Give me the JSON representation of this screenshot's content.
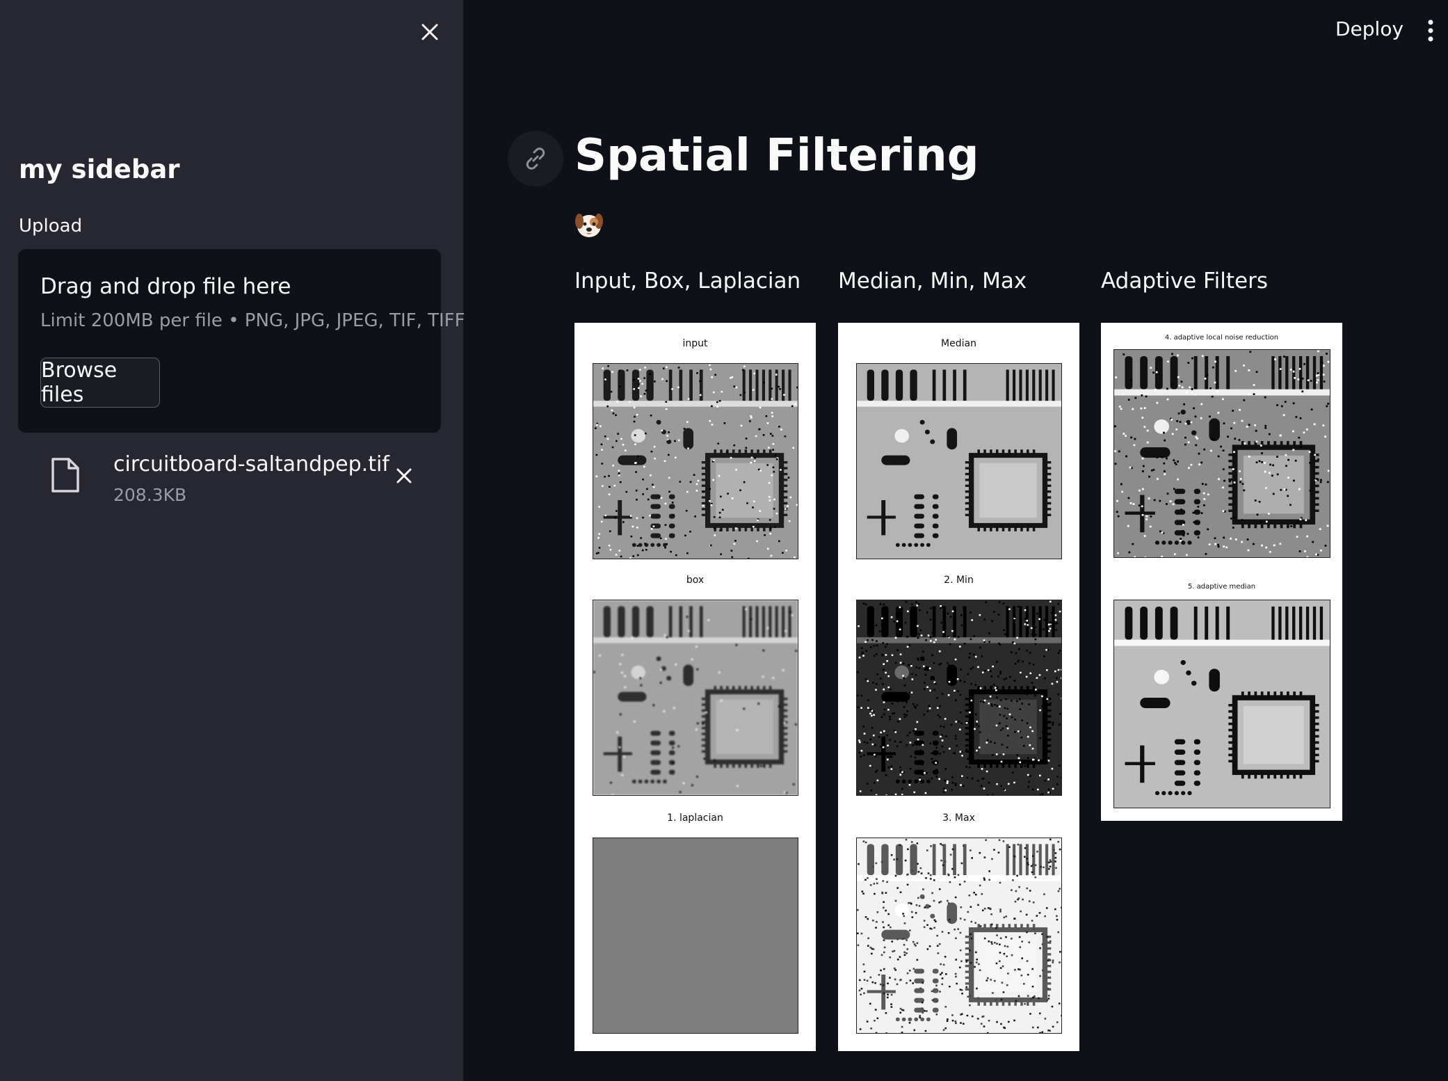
{
  "sidebar": {
    "title": "my sidebar",
    "upload_label": "Upload",
    "dropzone": {
      "title": "Drag and drop file here",
      "limit": "Limit 200MB per file • PNG, JPG, JPEG, TIF, TIFF",
      "browse_label": "Browse files"
    },
    "file": {
      "name": "circuitboard-saltandpep.tif",
      "size": "208.3KB"
    }
  },
  "header": {
    "deploy_label": "Deploy"
  },
  "main": {
    "title": "Spatial Filtering",
    "emoji": "dog-face-emoji",
    "columns": [
      {
        "heading": "Input, Box, Laplacian",
        "figures": [
          "input",
          "box",
          "1. laplacian"
        ]
      },
      {
        "heading": "Median, Min, Max",
        "figures": [
          "Median",
          "2. Min",
          "3. Max"
        ]
      },
      {
        "heading": "Adaptive Filters",
        "figures": [
          "4. adaptive local noise reduction",
          "5. adaptive median"
        ]
      }
    ]
  },
  "colors": {
    "app_background": "#0e1117",
    "sidebar_background": "#262730",
    "text": "#fafafa",
    "muted_text": "#9a9ca6"
  }
}
